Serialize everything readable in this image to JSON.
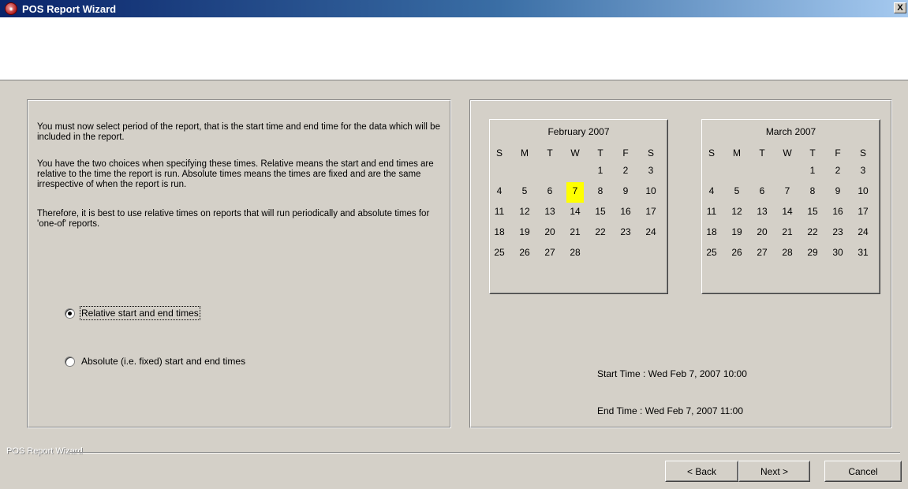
{
  "window": {
    "title": "POS Report Wizard",
    "close_label": "X",
    "icon": "app-logo-icon"
  },
  "info": {
    "paragraph1": "You must now select period of the report, that is the start time and end time for the data which will be included in the report.",
    "paragraph2": "You have the two choices when specifying these times. Relative means the start and end times are relative to the time the report is run. Absolute times means the times are fixed and are the same irrespective of when the report is run.",
    "paragraph3": "Therefore, it is best to use relative times on reports that will run periodically and absolute times for 'one-of' reports."
  },
  "options": {
    "relative_label": "Relative start and end times",
    "absolute_label": "Absolute (i.e. fixed) start and end times",
    "selected": "relative"
  },
  "calendars": [
    {
      "title": "February 2007",
      "days_of_week": [
        "S",
        "M",
        "T",
        "W",
        "T",
        "F",
        "S"
      ],
      "weeks": [
        [
          "",
          "",
          "",
          "",
          "1",
          "2",
          "3"
        ],
        [
          "4",
          "5",
          "6",
          "7",
          "8",
          "9",
          "10"
        ],
        [
          "11",
          "12",
          "13",
          "14",
          "15",
          "16",
          "17"
        ],
        [
          "18",
          "19",
          "20",
          "21",
          "22",
          "23",
          "24"
        ],
        [
          "25",
          "26",
          "27",
          "28",
          "",
          "",
          ""
        ]
      ],
      "selected_day": "7",
      "highlight_color": "#ffff00"
    },
    {
      "title": "March 2007",
      "days_of_week": [
        "S",
        "M",
        "T",
        "W",
        "T",
        "F",
        "S"
      ],
      "weeks": [
        [
          "",
          "",
          "",
          "",
          "1",
          "2",
          "3"
        ],
        [
          "4",
          "5",
          "6",
          "7",
          "8",
          "9",
          "10"
        ],
        [
          "11",
          "12",
          "13",
          "14",
          "15",
          "16",
          "17"
        ],
        [
          "18",
          "19",
          "20",
          "21",
          "22",
          "23",
          "24"
        ],
        [
          "25",
          "26",
          "27",
          "28",
          "29",
          "30",
          "31"
        ]
      ],
      "selected_day": ""
    }
  ],
  "times": {
    "start": "Start Time : Wed Feb 7, 2007 10:00",
    "end": "End Time : Wed Feb 7, 2007 11:00"
  },
  "footer": {
    "group_label": "POS Report Wizard",
    "back_label": "< Back",
    "next_label": "Next >",
    "cancel_label": "Cancel"
  }
}
